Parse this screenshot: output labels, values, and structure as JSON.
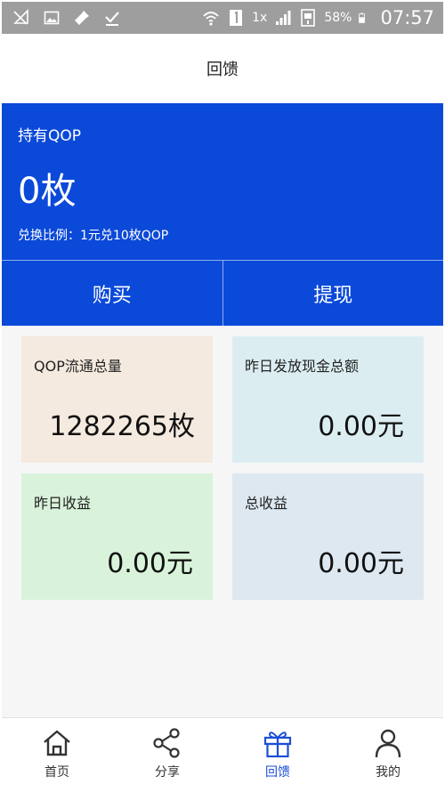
{
  "status_bar": {
    "icons_left": [
      "no-signal-icon",
      "image-icon",
      "flashlight-icon",
      "check-icon"
    ],
    "icons_right": [
      "wifi-icon",
      "sim-1-icon",
      "signal-icon",
      "sim-2-icon"
    ],
    "network_label": "1x",
    "battery": "58%",
    "time": "07:57"
  },
  "header": {
    "title": "回馈"
  },
  "hold_card": {
    "label": "持有QOP",
    "amount": "0枚",
    "rate": "兑换比例：1元兑10枚QOP",
    "buy_label": "购买",
    "withdraw_label": "提现",
    "color": "#0b49d9"
  },
  "stats": [
    {
      "label": "QOP流通总量",
      "value": "1282265枚",
      "bg": "#f4eadf"
    },
    {
      "label": "昨日发放现金总额",
      "value": "0.00元",
      "bg": "#dcedf2"
    },
    {
      "label": "昨日收益",
      "value": "0.00元",
      "bg": "#d9f3da"
    },
    {
      "label": "总收益",
      "value": "0.00元",
      "bg": "#dde8f1"
    }
  ],
  "bottom_nav": {
    "items": [
      {
        "label": "首页",
        "icon": "home-icon"
      },
      {
        "label": "分享",
        "icon": "share-icon"
      },
      {
        "label": "回馈",
        "icon": "gift-icon",
        "active": true
      },
      {
        "label": "我的",
        "icon": "user-icon"
      }
    ],
    "active_color": "#1a4fd6"
  }
}
